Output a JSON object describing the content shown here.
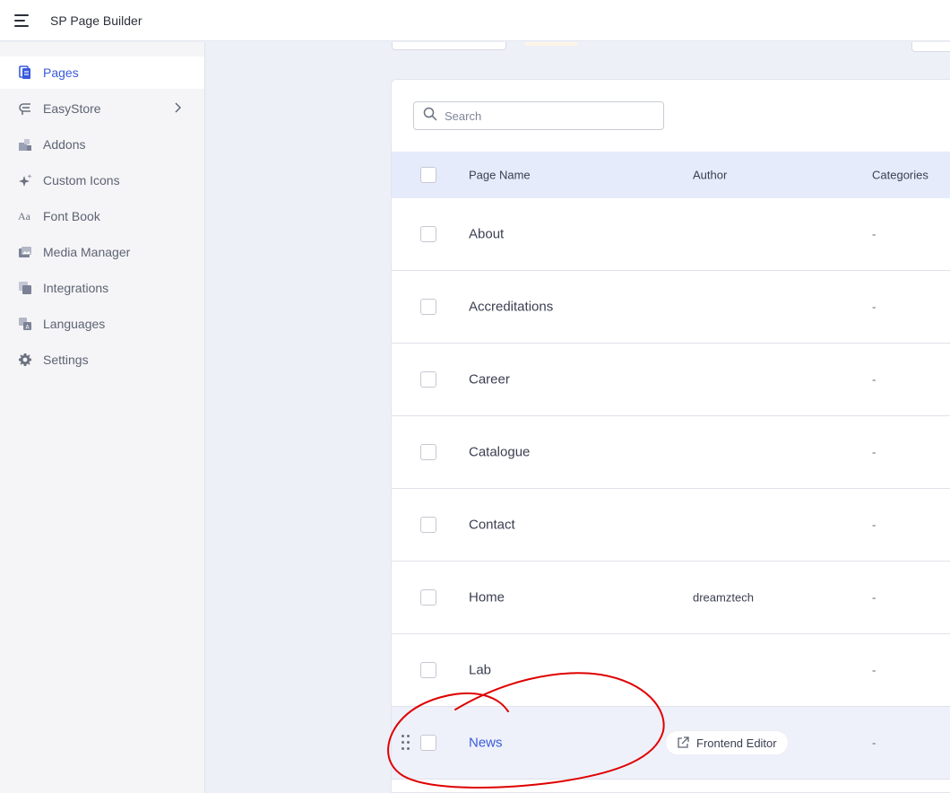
{
  "topbar": {
    "title": "SP Page Builder"
  },
  "sidebar": {
    "items": [
      {
        "label": "Pages",
        "icon": "pages-icon",
        "active": true
      },
      {
        "label": "EasyStore",
        "icon": "easystore-icon",
        "has_submenu": true
      },
      {
        "label": "Addons",
        "icon": "addons-icon"
      },
      {
        "label": "Custom Icons",
        "icon": "sparkle-icon"
      },
      {
        "label": "Font Book",
        "icon": "font-icon"
      },
      {
        "label": "Media Manager",
        "icon": "media-icon"
      },
      {
        "label": "Integrations",
        "icon": "integrations-icon"
      },
      {
        "label": "Languages",
        "icon": "languages-icon"
      },
      {
        "label": "Settings",
        "icon": "gear-icon"
      }
    ]
  },
  "search": {
    "placeholder": "Search"
  },
  "table": {
    "headers": {
      "name": "Page Name",
      "author": "Author",
      "categories": "Categories"
    },
    "rows": [
      {
        "name": "About",
        "author": "",
        "categories": "-"
      },
      {
        "name": "Accreditations",
        "author": "",
        "categories": "-"
      },
      {
        "name": "Career",
        "author": "",
        "categories": "-"
      },
      {
        "name": "Catalogue",
        "author": "",
        "categories": "-"
      },
      {
        "name": "Contact",
        "author": "",
        "categories": "-"
      },
      {
        "name": "Home",
        "author": "dreamztech",
        "categories": "-"
      },
      {
        "name": "Lab",
        "author": "",
        "categories": "-"
      },
      {
        "name": "News",
        "author": "",
        "categories": "-",
        "hovered": true,
        "action_label": "Frontend Editor"
      }
    ]
  },
  "colors": {
    "accent": "#3b5bdb",
    "annotation": "#e00000",
    "header_bg": "#e6ebfb"
  }
}
